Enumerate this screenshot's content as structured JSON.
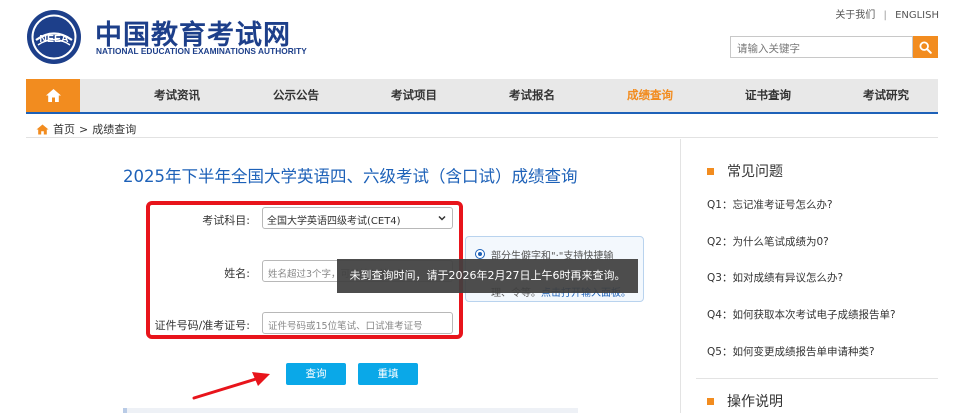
{
  "header": {
    "logo_cn": "中国教育考试网",
    "logo_en": "NATIONAL EDUCATION EXAMINATIONS AUTHORITY",
    "emblem_text": "NEEA",
    "top_links": [
      "关于我们",
      "ENGLISH"
    ],
    "top_link_separator": "|",
    "search_placeholder": "请输入关键字"
  },
  "nav": {
    "items": [
      "考试资讯",
      "公示公告",
      "考试项目",
      "考试报名",
      "成绩查询",
      "证书查询",
      "考试研究"
    ],
    "active_item": "成绩查询"
  },
  "breadcrumb": {
    "home": "首页",
    "separator": ">",
    "current": "成绩查询"
  },
  "main": {
    "title": "2025年下半年全国大学英语四、六级考试（含口试）成绩查询",
    "form": {
      "subject_label": "考试科目:",
      "subject_value": "全国大学英语四级考试(CET4)",
      "name_label": "姓名:",
      "name_placeholder": "姓名超过3个字，可只输入前3个",
      "id_label": "证件号码/准考证号:",
      "id_placeholder": "证件号码或15位笔试、口试准考证号"
    },
    "tip": {
      "line1": "部分生僻字和\"·\"支持快捷输",
      "line2_prefix": "理、令等。",
      "line2_link": "点击打开输入面板。"
    },
    "toast": "未到查询时间，请于2026年2月27日上午6时再来查询。",
    "query_button": "查询",
    "reset_button": "重填"
  },
  "sidebar": {
    "faq_title": "常见问题",
    "faq_items": [
      "Q1：忘记准考证号怎么办?",
      "Q2：为什么笔试成绩为0?",
      "Q3：如对成绩有异议怎么办?",
      "Q4：如何获取本次考试电子成绩报告单?",
      "Q5：如何变更成绩报告单申请种类?"
    ],
    "ops_title": "操作说明"
  },
  "colors": {
    "brand_blue": "#1d3f8a",
    "link_blue": "#1d61b8",
    "accent_orange": "#f28c1f",
    "button_cyan": "#0aa8e8",
    "highlight_red": "#e8141b"
  }
}
